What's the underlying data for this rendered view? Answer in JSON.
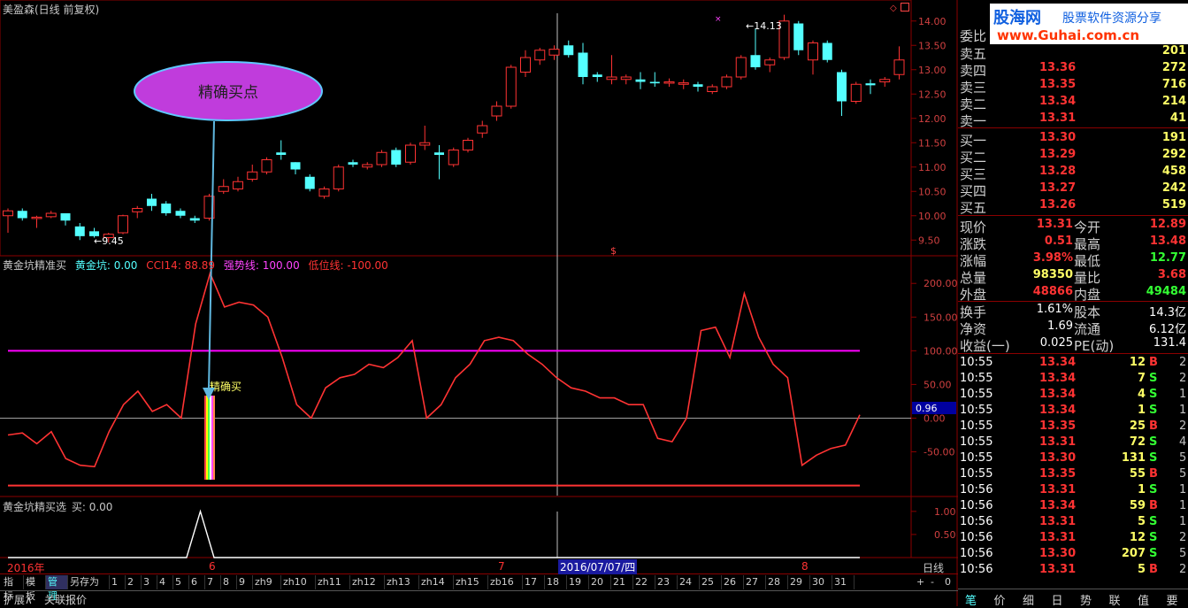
{
  "stock_title": "美盈森(日线 前复权)",
  "colors": {
    "up": "#ff3333",
    "down": "#54ffff",
    "grid": "#8b0000",
    "magenta": "#ff00ff",
    "yellow": "#ffff66",
    "cyan": "#54ffff",
    "white": "#ffffff",
    "green": "#33ff33"
  },
  "main_chart": {
    "price_ticks": [
      "14.00",
      "13.50",
      "13.00",
      "12.50",
      "12.00",
      "11.50",
      "11.00",
      "10.50",
      "10.00",
      "9.50"
    ],
    "low_annot": "←9.45",
    "high_annot": "←14.13",
    "dollar_mark": "$",
    "ellipse_text": "精确买点"
  },
  "indicator": {
    "name": "黄金坑精准买",
    "label_jk": "黄金坑: 0.00",
    "label_cci": "CCI14: 88.89",
    "label_strong": "强势线: 100.00",
    "label_low": "低位线: -100.00",
    "ticks": [
      "200.00",
      "150.00",
      "100.00",
      "50.00",
      "0.00",
      "-50.00"
    ],
    "current_value": "0.96",
    "buy_text": "精确买"
  },
  "sub_indicator": {
    "name": "黄金坑精买选",
    "label": "买: 0.00",
    "ticks": [
      "1.00",
      "0.50"
    ]
  },
  "timeline": {
    "year": "2016年",
    "m6": "6",
    "m7": "7",
    "m8": "8",
    "cursor_date": "2016/07/07/四",
    "period": "日线"
  },
  "bottom_tabs": [
    "指标",
    "模板",
    "管理",
    "另存为",
    "1",
    "2",
    "3",
    "4",
    "5",
    "6",
    "7",
    "8",
    "9",
    "zh9",
    "zh10",
    "zh11",
    "zh12",
    "zh13",
    "zh14",
    "zh15",
    "zb16",
    "17",
    "18",
    "19",
    "20",
    "21",
    "22",
    "23",
    "24",
    "25",
    "26",
    "27",
    "28",
    "29",
    "30",
    "31"
  ],
  "status_tabs": [
    "扩展∧",
    "关联报价"
  ],
  "zoom_controls": [
    "+",
    "-",
    "0"
  ],
  "right_tabs": [
    "笔",
    "价",
    "细",
    "日",
    "势",
    "联",
    "值",
    "要"
  ],
  "watermark": {
    "site": "股海网",
    "slogan": "股票软件资源分享",
    "url": "www.Guhai.com.cn"
  },
  "order_book": {
    "header": "委比",
    "sells": [
      {
        "label": "卖五",
        "price": "",
        "vol": "201"
      },
      {
        "label": "卖四",
        "price": "13.36",
        "vol": "272"
      },
      {
        "label": "卖三",
        "price": "13.35",
        "vol": "716"
      },
      {
        "label": "卖二",
        "price": "13.34",
        "vol": "214"
      },
      {
        "label": "卖一",
        "price": "13.31",
        "vol": "41"
      }
    ],
    "buys": [
      {
        "label": "买一",
        "price": "13.30",
        "vol": "191"
      },
      {
        "label": "买二",
        "price": "13.29",
        "vol": "292"
      },
      {
        "label": "买三",
        "price": "13.28",
        "vol": "458"
      },
      {
        "label": "买四",
        "price": "13.27",
        "vol": "242"
      },
      {
        "label": "买五",
        "price": "13.26",
        "vol": "519"
      }
    ]
  },
  "quote": {
    "now_l": "现价",
    "now_v": "13.31",
    "open_l": "今开",
    "open_v": "12.89",
    "chg_l": "涨跌",
    "chg_v": "0.51",
    "high_l": "最高",
    "high_v": "13.48",
    "pct_l": "涨幅",
    "pct_v": "3.98%",
    "low_l": "最低",
    "low_v": "12.77",
    "vol_l": "总量",
    "vol_v": "98350",
    "vr_l": "量比",
    "vr_v": "3.68",
    "out_l": "外盘",
    "out_v": "48866",
    "in_l": "内盘",
    "in_v": "49484"
  },
  "fund": {
    "turn_l": "换手",
    "turn_v": "1.61%",
    "cap_l": "股本",
    "cap_v": "14.3亿",
    "nav_l": "净资",
    "nav_v": "1.69",
    "flow_l": "流通",
    "flow_v": "6.12亿",
    "eps_l": "收益(一)",
    "eps_v": "0.025",
    "pe_l": "PE(动)",
    "pe_v": "131.4"
  },
  "ticks_list": [
    {
      "time": "10:55",
      "price": "13.34",
      "vol": "12",
      "bs": "B",
      "n": "2"
    },
    {
      "time": "10:55",
      "price": "13.34",
      "vol": "7",
      "bs": "S",
      "n": "2"
    },
    {
      "time": "10:55",
      "price": "13.34",
      "vol": "4",
      "bs": "S",
      "n": "1"
    },
    {
      "time": "10:55",
      "price": "13.34",
      "vol": "1",
      "bs": "S",
      "n": "1"
    },
    {
      "time": "10:55",
      "price": "13.35",
      "vol": "25",
      "bs": "B",
      "n": "2"
    },
    {
      "time": "10:55",
      "price": "13.31",
      "vol": "72",
      "bs": "S",
      "n": "4"
    },
    {
      "time": "10:55",
      "price": "13.30",
      "vol": "131",
      "bs": "S",
      "n": "5"
    },
    {
      "time": "10:55",
      "price": "13.35",
      "vol": "55",
      "bs": "B",
      "n": "5"
    },
    {
      "time": "10:56",
      "price": "13.31",
      "vol": "1",
      "bs": "S",
      "n": "1"
    },
    {
      "time": "10:56",
      "price": "13.34",
      "vol": "59",
      "bs": "B",
      "n": "1"
    },
    {
      "time": "10:56",
      "price": "13.31",
      "vol": "5",
      "bs": "S",
      "n": "1"
    },
    {
      "time": "10:56",
      "price": "13.31",
      "vol": "12",
      "bs": "S",
      "n": "2"
    },
    {
      "time": "10:56",
      "price": "13.30",
      "vol": "207",
      "bs": "S",
      "n": "5"
    },
    {
      "time": "10:56",
      "price": "13.31",
      "vol": "5",
      "bs": "B",
      "n": "2"
    }
  ],
  "chart_data": [
    {
      "type": "candlestick",
      "title": "美盈森(日线 前复权)",
      "ylim": [
        9.3,
        14.2
      ],
      "candles": [
        {
          "o": 10.0,
          "c": 10.1,
          "h": 10.15,
          "l": 9.65
        },
        {
          "o": 10.1,
          "c": 9.95,
          "h": 10.15,
          "l": 9.9
        },
        {
          "o": 9.95,
          "c": 9.97,
          "h": 10.0,
          "l": 9.75
        },
        {
          "o": 9.98,
          "c": 10.05,
          "h": 10.1,
          "l": 9.95
        },
        {
          "o": 10.05,
          "c": 9.9,
          "h": 10.05,
          "l": 9.8
        },
        {
          "o": 9.78,
          "c": 9.58,
          "h": 9.85,
          "l": 9.5
        },
        {
          "o": 9.68,
          "c": 9.58,
          "h": 9.75,
          "l": 9.55
        },
        {
          "o": 9.55,
          "c": 9.62,
          "h": 9.65,
          "l": 9.45
        },
        {
          "o": 9.65,
          "c": 10.0,
          "h": 10.02,
          "l": 9.62
        },
        {
          "o": 10.08,
          "c": 10.15,
          "h": 10.2,
          "l": 9.95
        },
        {
          "o": 10.35,
          "c": 10.2,
          "h": 10.45,
          "l": 10.1
        },
        {
          "o": 10.25,
          "c": 10.05,
          "h": 10.3,
          "l": 10.0
        },
        {
          "o": 10.1,
          "c": 10.0,
          "h": 10.15,
          "l": 9.95
        },
        {
          "o": 9.95,
          "c": 9.9,
          "h": 10.0,
          "l": 9.85
        },
        {
          "o": 9.95,
          "c": 10.4,
          "h": 10.45,
          "l": 9.9
        },
        {
          "o": 10.5,
          "c": 10.6,
          "h": 10.75,
          "l": 10.45
        },
        {
          "o": 10.55,
          "c": 10.7,
          "h": 10.8,
          "l": 10.5
        },
        {
          "o": 10.75,
          "c": 10.9,
          "h": 11.05,
          "l": 10.7
        },
        {
          "o": 10.9,
          "c": 11.15,
          "h": 11.2,
          "l": 10.85
        },
        {
          "o": 11.3,
          "c": 11.25,
          "h": 11.55,
          "l": 11.15
        },
        {
          "o": 11.1,
          "c": 10.95,
          "h": 11.1,
          "l": 10.85
        },
        {
          "o": 10.8,
          "c": 10.55,
          "h": 10.85,
          "l": 10.5
        },
        {
          "o": 10.4,
          "c": 10.55,
          "h": 10.6,
          "l": 10.35
        },
        {
          "o": 10.55,
          "c": 11.0,
          "h": 11.05,
          "l": 10.5
        },
        {
          "o": 11.1,
          "c": 11.05,
          "h": 11.15,
          "l": 11.0
        },
        {
          "o": 11.0,
          "c": 11.05,
          "h": 11.1,
          "l": 10.95
        },
        {
          "o": 11.05,
          "c": 11.3,
          "h": 11.35,
          "l": 11.0
        },
        {
          "o": 11.35,
          "c": 11.05,
          "h": 11.4,
          "l": 11.0
        },
        {
          "o": 11.1,
          "c": 11.45,
          "h": 11.5,
          "l": 11.05
        },
        {
          "o": 11.45,
          "c": 11.5,
          "h": 11.85,
          "l": 11.35
        },
        {
          "o": 11.3,
          "c": 11.25,
          "h": 11.45,
          "l": 10.75
        },
        {
          "o": 11.05,
          "c": 11.35,
          "h": 11.4,
          "l": 11.0
        },
        {
          "o": 11.35,
          "c": 11.55,
          "h": 11.6,
          "l": 11.3
        },
        {
          "o": 11.7,
          "c": 11.85,
          "h": 11.95,
          "l": 11.6
        },
        {
          "o": 12.05,
          "c": 12.25,
          "h": 12.35,
          "l": 11.95
        },
        {
          "o": 12.25,
          "c": 13.05,
          "h": 13.1,
          "l": 12.2
        },
        {
          "o": 12.95,
          "c": 13.25,
          "h": 13.4,
          "l": 12.85
        },
        {
          "o": 13.2,
          "c": 13.4,
          "h": 13.45,
          "l": 13.1
        },
        {
          "o": 13.3,
          "c": 13.42,
          "h": 13.5,
          "l": 13.2
        },
        {
          "o": 13.5,
          "c": 13.3,
          "h": 13.6,
          "l": 13.25
        },
        {
          "o": 13.35,
          "c": 12.85,
          "h": 13.55,
          "l": 12.7
        },
        {
          "o": 12.9,
          "c": 12.85,
          "h": 12.95,
          "l": 12.75
        },
        {
          "o": 12.8,
          "c": 12.85,
          "h": 13.3,
          "l": 12.7
        },
        {
          "o": 12.8,
          "c": 12.85,
          "h": 12.9,
          "l": 12.7
        },
        {
          "o": 12.8,
          "c": 12.75,
          "h": 12.95,
          "l": 12.6
        },
        {
          "o": 12.75,
          "c": 12.72,
          "h": 12.95,
          "l": 12.65
        },
        {
          "o": 12.73,
          "c": 12.75,
          "h": 12.82,
          "l": 12.65
        },
        {
          "o": 12.7,
          "c": 12.73,
          "h": 12.8,
          "l": 12.6
        },
        {
          "o": 12.7,
          "c": 12.65,
          "h": 12.75,
          "l": 12.55
        },
        {
          "o": 12.55,
          "c": 12.65,
          "h": 12.7,
          "l": 12.5
        },
        {
          "o": 12.65,
          "c": 12.85,
          "h": 12.9,
          "l": 12.6
        },
        {
          "o": 12.85,
          "c": 13.25,
          "h": 13.3,
          "l": 12.8
        },
        {
          "o": 13.3,
          "c": 13.05,
          "h": 13.85,
          "l": 13.0
        },
        {
          "o": 13.1,
          "c": 13.2,
          "h": 13.25,
          "l": 12.95
        },
        {
          "o": 13.25,
          "c": 14.0,
          "h": 14.13,
          "l": 13.2
        },
        {
          "o": 13.95,
          "c": 13.4,
          "h": 14.0,
          "l": 13.3
        },
        {
          "o": 13.2,
          "c": 13.55,
          "h": 13.6,
          "l": 12.9
        },
        {
          "o": 13.55,
          "c": 13.2,
          "h": 13.6,
          "l": 13.15
        },
        {
          "o": 12.95,
          "c": 12.35,
          "h": 13.0,
          "l": 12.05
        },
        {
          "o": 12.35,
          "c": 12.7,
          "h": 12.75,
          "l": 12.3
        },
        {
          "o": 12.72,
          "c": 12.68,
          "h": 12.8,
          "l": 12.5
        },
        {
          "o": 12.75,
          "c": 12.8,
          "h": 12.85,
          "l": 12.65
        },
        {
          "o": 12.9,
          "c": 13.2,
          "h": 13.48,
          "l": 12.8
        }
      ]
    },
    {
      "type": "line",
      "title": "黄金坑精准买",
      "ylim": [
        -110,
        225
      ],
      "series": [
        {
          "name": "CCI14",
          "values": [
            -25,
            -22,
            -38,
            -20,
            -60,
            -70,
            -72,
            -20,
            20,
            40,
            10,
            20,
            0,
            140,
            215,
            165,
            172,
            168,
            150,
            90,
            20,
            0,
            45,
            60,
            65,
            80,
            75,
            90,
            115,
            0,
            20,
            60,
            80,
            115,
            120,
            115,
            95,
            80,
            60,
            45,
            40,
            30,
            30,
            20,
            20,
            -30,
            -35,
            0,
            130,
            135,
            90,
            185,
            120,
            80,
            60,
            -70,
            -55,
            -45,
            -40,
            5
          ]
        },
        {
          "name": "强势线",
          "values": [
            100
          ]
        },
        {
          "name": "低位线",
          "values": [
            -100
          ]
        }
      ]
    },
    {
      "type": "line",
      "title": "黄金坑精买选",
      "ylim": [
        0,
        1.15
      ],
      "series": [
        {
          "name": "买",
          "values": [
            0,
            0,
            0,
            0,
            0,
            0,
            0,
            0,
            0,
            0,
            0,
            0,
            0,
            0,
            1,
            0,
            0,
            0,
            0,
            0,
            0,
            0,
            0,
            0,
            0,
            0,
            0,
            0,
            0,
            0,
            0,
            0,
            0,
            0,
            0,
            0,
            0,
            0,
            0,
            0,
            0,
            0,
            0,
            0,
            0,
            0,
            0,
            0,
            0,
            0,
            0,
            0,
            0,
            0,
            0,
            0,
            0,
            0,
            0,
            0,
            0,
            0,
            0
          ]
        }
      ]
    }
  ]
}
